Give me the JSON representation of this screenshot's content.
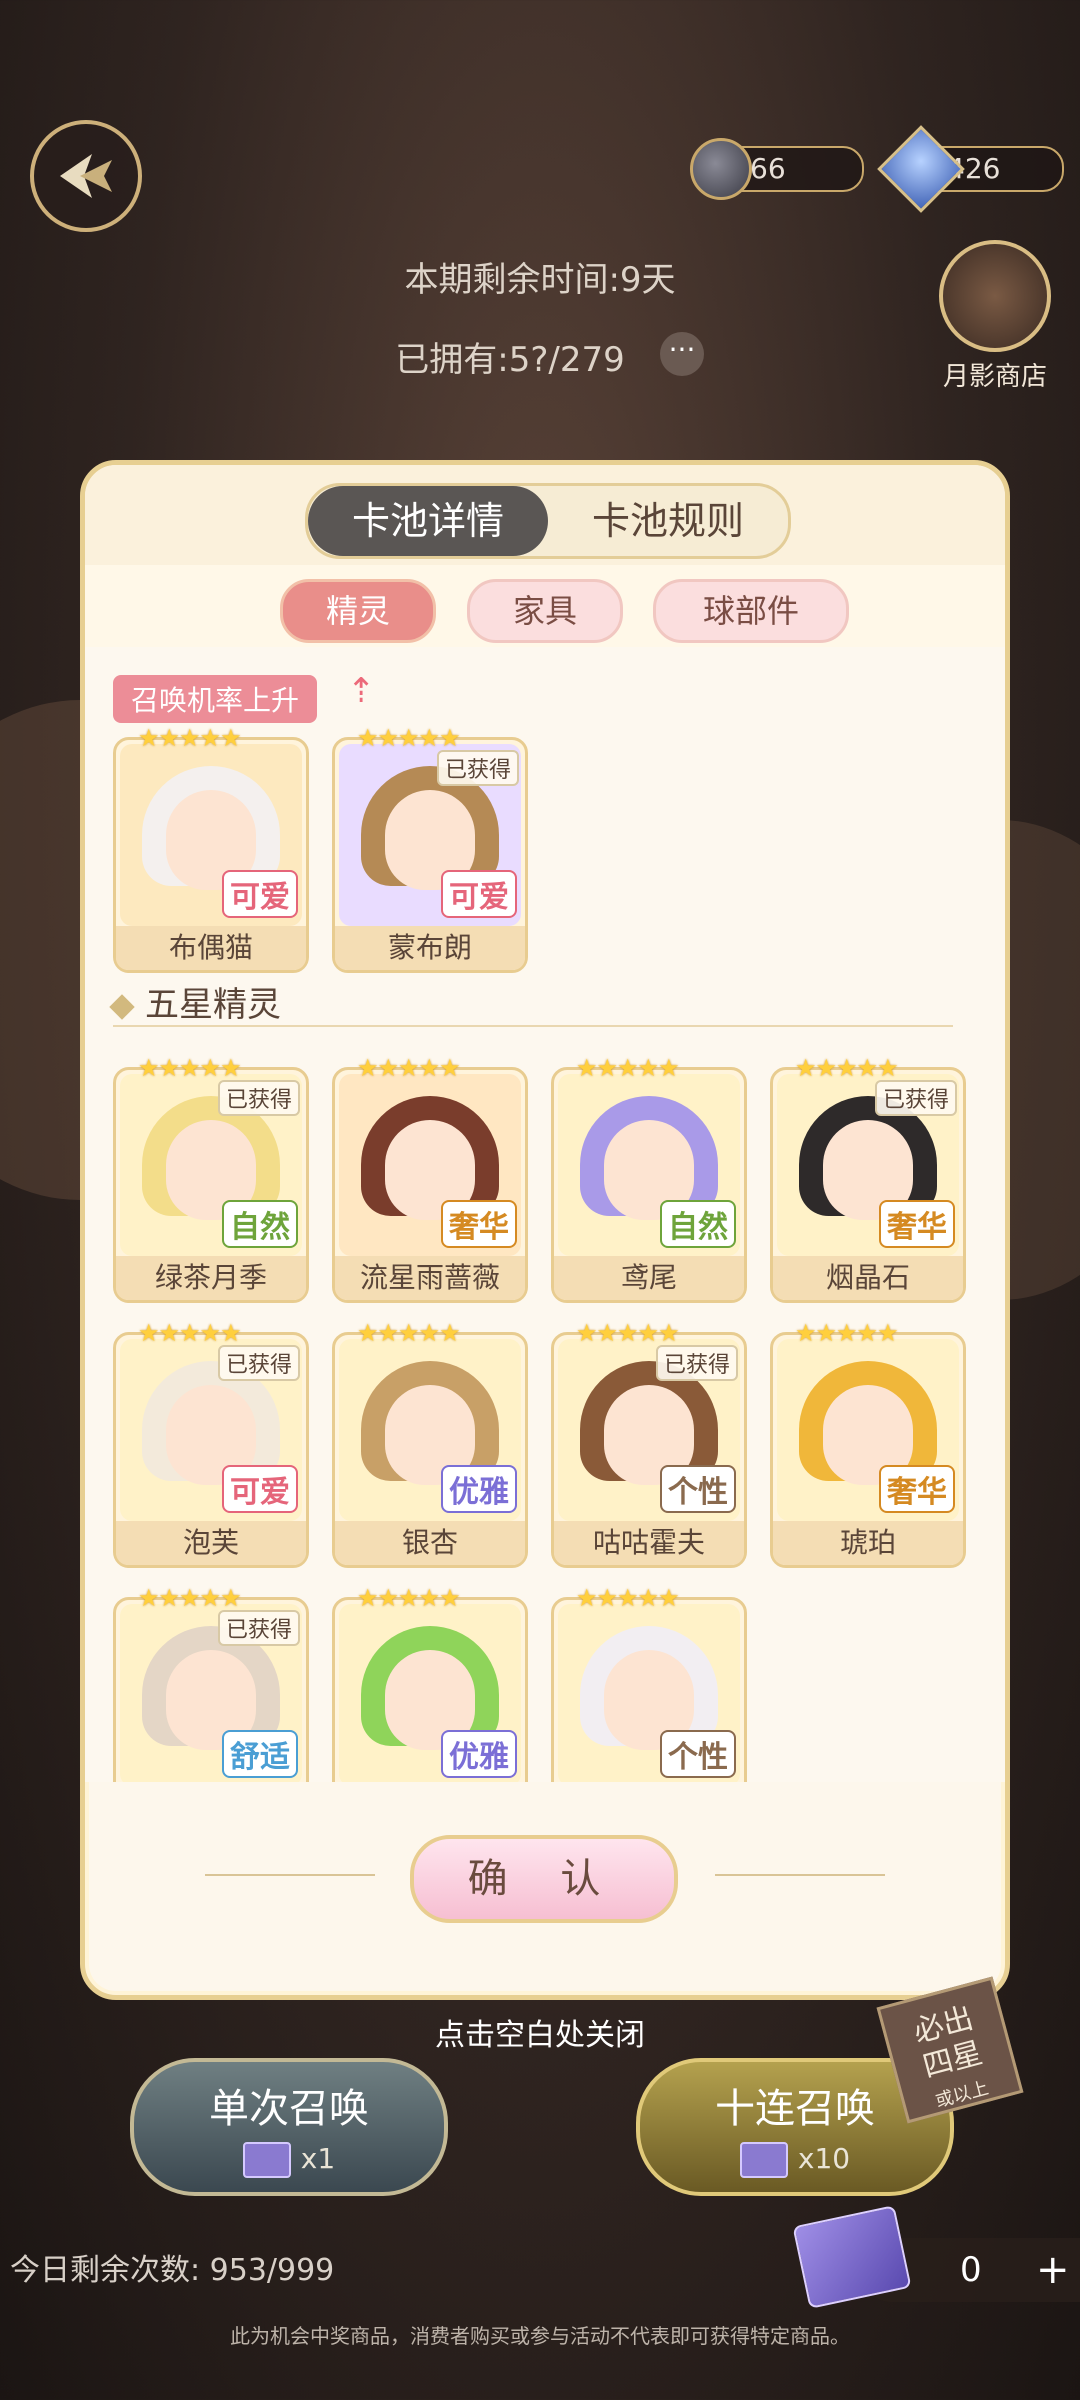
{
  "topbar": {
    "moon_coins": "66",
    "gems": "426"
  },
  "banner": {
    "remaining_time": "本期剩余时间:9天",
    "owned": "已拥有:5?/279"
  },
  "shop": {
    "label": "月影商店"
  },
  "panel": {
    "tabs": [
      "卡池详情",
      "卡池规则"
    ],
    "subtabs": [
      "精灵",
      "家具",
      "球部件"
    ],
    "rate_up_label": "召唤机率上升",
    "five_star_title": "五星精灵",
    "confirm_label": "确 认"
  },
  "rate_up": [
    {
      "name": "布偶猫",
      "trait": "可爱",
      "owned": "",
      "hair": "#f4f0ee",
      "bg": "#fde9bf",
      "trait_color": "#e5657a"
    },
    {
      "name": "蒙布朗",
      "trait": "可爱",
      "owned": "已获得",
      "hair": "#b58a55",
      "bg": "#e9dcff",
      "trait_color": "#e5657a"
    }
  ],
  "five_star": [
    {
      "name": "绿茶月季",
      "trait": "自然",
      "owned": "已获得",
      "hair": "#f3dd8a",
      "bg": "#fff2c8",
      "trait_color": "#6ea43b"
    },
    {
      "name": "流星雨蔷薇",
      "trait": "奢华",
      "owned": "",
      "hair": "#7a3d2c",
      "bg": "#ffe7c2",
      "trait_color": "#d58a22"
    },
    {
      "name": "鸢尾",
      "trait": "自然",
      "owned": "",
      "hair": "#a99ae8",
      "bg": "#fff2c8",
      "trait_color": "#6ea43b"
    },
    {
      "name": "烟晶石",
      "trait": "奢华",
      "owned": "已获得",
      "hair": "#2e2a2a",
      "bg": "#fff2c8",
      "trait_color": "#d58a22"
    },
    {
      "name": "泡芙",
      "trait": "可爱",
      "owned": "已获得",
      "hair": "#f3eadb",
      "bg": "#fff2c8",
      "trait_color": "#e5657a"
    },
    {
      "name": "银杏",
      "trait": "优雅",
      "owned": "",
      "hair": "#c8a067",
      "bg": "#fff2c8",
      "trait_color": "#7b6fd6"
    },
    {
      "name": "咕咕霍夫",
      "trait": "个性",
      "owned": "已获得",
      "hair": "#8a5a38",
      "bg": "#fff2c8",
      "trait_color": "#8a6a4e"
    },
    {
      "name": "琥珀",
      "trait": "奢华",
      "owned": "",
      "hair": "#f0b73a",
      "bg": "#fff2c8",
      "trait_color": "#d58a22"
    },
    {
      "name": "",
      "trait": "舒适",
      "owned": "已获得",
      "hair": "#e4d6c6",
      "bg": "#fff2c8",
      "trait_color": "#4a9ed4"
    },
    {
      "name": "",
      "trait": "优雅",
      "owned": "",
      "hair": "#8fd45a",
      "bg": "#fff2c8",
      "trait_color": "#7b6fd6"
    },
    {
      "name": "",
      "trait": "个性",
      "owned": "",
      "hair": "#f2eef2",
      "bg": "#fff2c8",
      "trait_color": "#8a6a4e"
    }
  ],
  "close_hint": "点击空白处关闭",
  "summon": {
    "single_label": "单次召唤",
    "single_cost": "x1",
    "ten_label": "十连召唤",
    "ten_cost": "x10",
    "guarantee_line1": "必出",
    "guarantee_line2": "四星",
    "guarantee_small": "或以上"
  },
  "bottom": {
    "remaining_today": "今日剩余次数: 953/999",
    "ticket_count": "0",
    "disclaimer": "此为机会中奖商品，消费者购买或参与活动不代表即可获得特定商品。"
  }
}
